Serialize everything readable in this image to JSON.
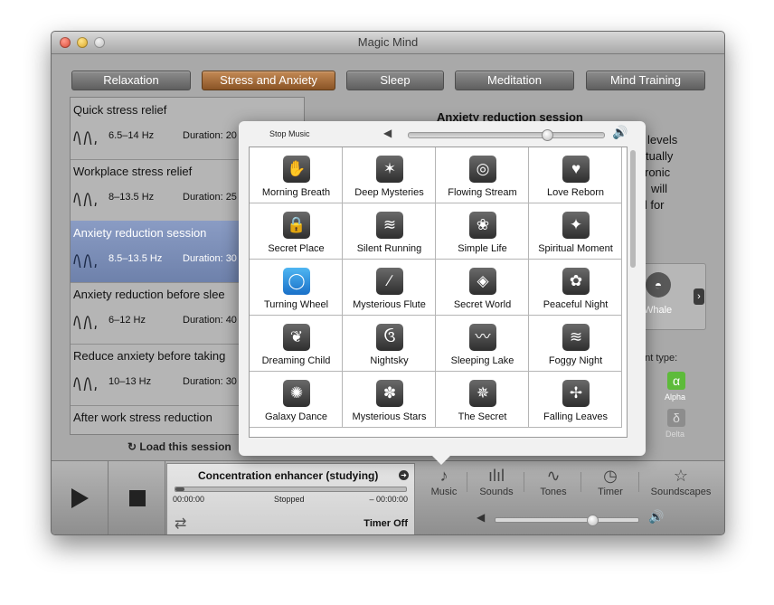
{
  "window": {
    "title": "Magic Mind"
  },
  "tabs": [
    "Relaxation",
    "Stress and Anxiety",
    "Sleep",
    "Meditation",
    "Mind Training"
  ],
  "sessions": [
    {
      "title": "Quick stress relief",
      "hz": "6.5–14 Hz",
      "duration": "Duration: 20"
    },
    {
      "title": "Workplace stress relief",
      "hz": "8–13.5 Hz",
      "duration": "Duration: 25"
    },
    {
      "title": "Anxiety reduction session",
      "hz": "8.5–13.5 Hz",
      "duration": "Duration: 30"
    },
    {
      "title": "Anxiety reduction before slee",
      "hz": "6–12 Hz",
      "duration": "Duration: 40"
    },
    {
      "title": "Reduce anxiety before taking",
      "hz": "10–13 Hz",
      "duration": "Duration: 30"
    },
    {
      "title": "After work stress reduction",
      "hz": "",
      "duration": ""
    }
  ],
  "load_session": "Load this session",
  "right_panel": {
    "title": "Anxiety reduction session",
    "text_lines": [
      "levels",
      "tually",
      "ronic",
      "will",
      "ful for"
    ],
    "carousel_label": "Whale",
    "entrainment_label": "ent type:",
    "brainwaves": [
      {
        "symbol": "α",
        "label": "Alpha"
      },
      {
        "symbol": "δ",
        "label": "Delta"
      }
    ]
  },
  "popover": {
    "stop_music": "Stop Music",
    "volume_level": 0.71,
    "music": [
      "Morning Breath",
      "Deep Mysteries",
      "Flowing Stream",
      "Love Reborn",
      "Secret Place",
      "Silent Running",
      "Simple Life",
      "Spiritual Moment",
      "Turning Wheel",
      "Mysterious Flute",
      "Secret World",
      "Peaceful Night",
      "Dreaming Child",
      "Nightsky",
      "Sleeping Lake",
      "Foggy Night",
      "Galaxy Dance",
      "Mysterious Stars",
      "The Secret",
      "Falling Leaves"
    ],
    "icons": [
      "✋",
      "✶",
      "◎",
      "♥",
      "🔒",
      "≋",
      "❀",
      "✦",
      "◯",
      "∕",
      "◈",
      "✿",
      "❦",
      "ઉ",
      "〰",
      "≋",
      "✺",
      "✽",
      "✵",
      "✢"
    ]
  },
  "player": {
    "track": "Concentration enhancer (studying)",
    "time_elapsed": "00:00:00",
    "status": "Stopped",
    "time_remaining": "– 00:00:00",
    "timer": "Timer Off",
    "progress": 0.04
  },
  "nav": [
    {
      "label": "Music",
      "icon": "♪"
    },
    {
      "label": "Sounds",
      "icon": "ılıl"
    },
    {
      "label": "Tones",
      "icon": "∿"
    },
    {
      "label": "Timer",
      "icon": "◷"
    },
    {
      "label": "Soundscapes",
      "icon": "☆"
    }
  ],
  "master_volume_level": 0.68
}
